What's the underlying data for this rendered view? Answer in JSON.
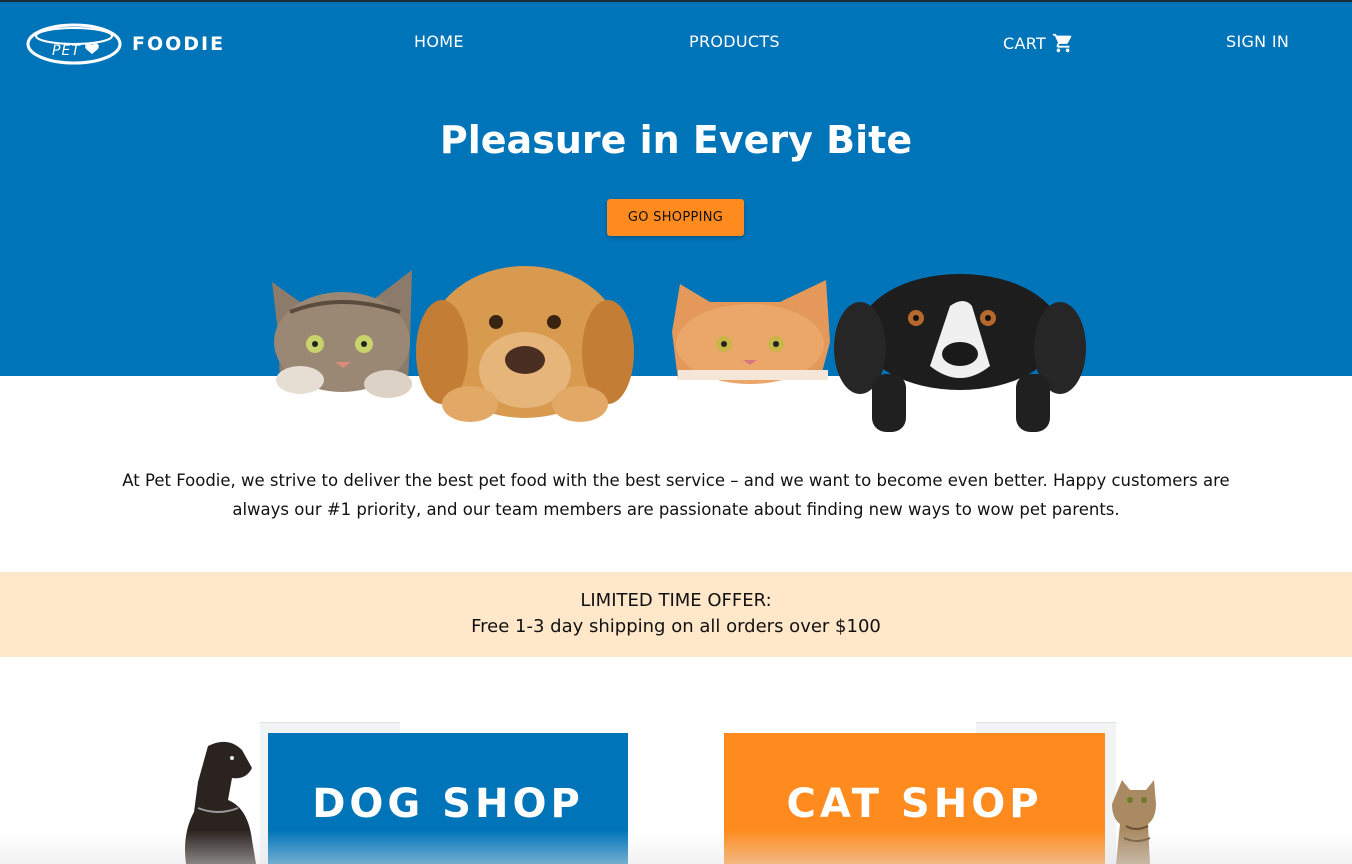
{
  "brand": {
    "logo_bowl_text": "PET",
    "name": "FOODIE"
  },
  "nav": {
    "home": "HOME",
    "products": "PRODUCTS",
    "cart": "CART",
    "sign_in": "SIGN IN"
  },
  "hero": {
    "title": "Pleasure in Every Bite",
    "cta": "GO SHOPPING"
  },
  "about": {
    "text": "At Pet Foodie, we strive to deliver the best pet food with the best service – and we want to become even better. Happy customers are always our #1 priority, and our team members are passionate about finding new ways to wow pet parents."
  },
  "offer": {
    "heading": "LIMITED TIME OFFER:",
    "detail": "Free 1-3 day shipping on all orders over $100"
  },
  "shops": {
    "dog": "DOG SHOP",
    "cat": "CAT SHOP"
  },
  "colors": {
    "brand_blue": "#0074b9",
    "accent_orange": "#ff8b1f",
    "offer_bg": "#ffe7c9"
  },
  "icons": [
    "cart-icon",
    "heart-icon"
  ]
}
